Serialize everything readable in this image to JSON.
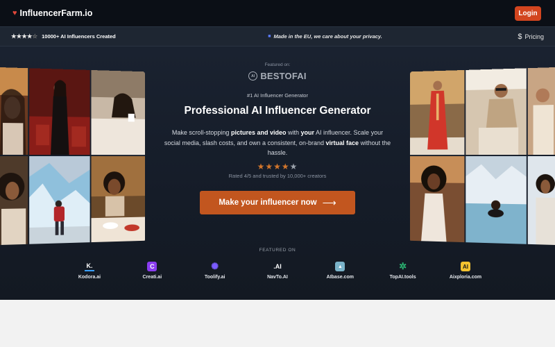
{
  "brand": {
    "name": "InfluencerFarm.io"
  },
  "header": {
    "login_label": "Login"
  },
  "subbar": {
    "stars": "★★★★",
    "star_off": "☆",
    "created_text": "10000+ AI Influencers Created",
    "privacy_text": "Made in the EU, we care about your privacy.",
    "pricing_label": "Pricing"
  },
  "hero": {
    "featured_label": "Featured on:",
    "featured_brand": "BESTOFAI",
    "badge_text": "AI",
    "eyebrow": "#1 AI Influencer Generator",
    "headline": "Professional AI Influencer Generator",
    "desc_1": "Make scroll-stopping ",
    "desc_bold_1": "pictures and video",
    "desc_2": " with ",
    "desc_bold_2": "your",
    "desc_3": " AI influencer. Scale your social media, slash costs, and own a consistent, on-brand ",
    "desc_bold_3": "virtual face",
    "desc_4": " without the hassle.",
    "stars_on": "★★★★",
    "stars_off": "★",
    "rating_value": 4,
    "rating_max": 5,
    "rated_text": "Rated 4/5 and trusted by 10,000+ creators",
    "cta_label": "Make your influencer now"
  },
  "featured": {
    "heading": "FEATURED ON",
    "logos": [
      {
        "mark": "K.",
        "name": "Kodora.ai",
        "color": "#ffffff",
        "bg": "transparent"
      },
      {
        "mark": "C",
        "name": "Creati.ai",
        "color": "#ffffff",
        "bg": "#8a3cf0"
      },
      {
        "mark": "✺",
        "name": "Toolify.ai",
        "color": "#7b5cff",
        "bg": "transparent"
      },
      {
        "mark": ".AI",
        "name": "NavTo.AI",
        "color": "#ffffff",
        "bg": "transparent"
      },
      {
        "mark": "▲",
        "name": "AIbase.com",
        "color": "#ffffff",
        "bg": "#7ab3c9"
      },
      {
        "mark": "✲",
        "name": "TopAI.tools",
        "color": "#2bb673",
        "bg": "transparent"
      },
      {
        "mark": "AI",
        "name": "Aixploria.com",
        "color": "#1a1a1a",
        "bg": "#f2c230"
      }
    ]
  },
  "colors": {
    "accent": "#c2561f",
    "login": "#d2451f",
    "heart": "#e0473a"
  },
  "gallery_icons": [
    "woman-portrait-photo",
    "woman-black-dress-photo",
    "woman-bed-coffee-photo",
    "woman-curly-hair-photo",
    "glacier-hiker-photo",
    "woman-dining-photo",
    "woman-red-suit-photo",
    "man-private-jet-photo",
    "woman-white-dress-photo",
    "woman-hot-spring-photo"
  ]
}
